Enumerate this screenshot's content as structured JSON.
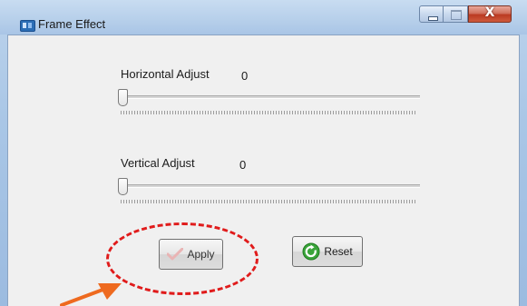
{
  "window": {
    "title": "Frame Effect",
    "app_icon": "app-icon",
    "controls": [
      "minimize-icon",
      "maximize-icon",
      "close-icon"
    ],
    "close_glyph": "X"
  },
  "horizontal": {
    "label": "Horizontal Adjust",
    "value": "0",
    "slider_level": 0
  },
  "vertical": {
    "label": "Vertical Adjust",
    "value": "0",
    "slider_level": 0
  },
  "buttons": {
    "apply_label": "Apply",
    "apply_icon": "checkmark-icon",
    "reset_label": "Reset",
    "reset_icon": "refresh-icon"
  },
  "annotation": {
    "highlight_color": "#e01b1b",
    "arrow_color": "#ee6a1f"
  }
}
